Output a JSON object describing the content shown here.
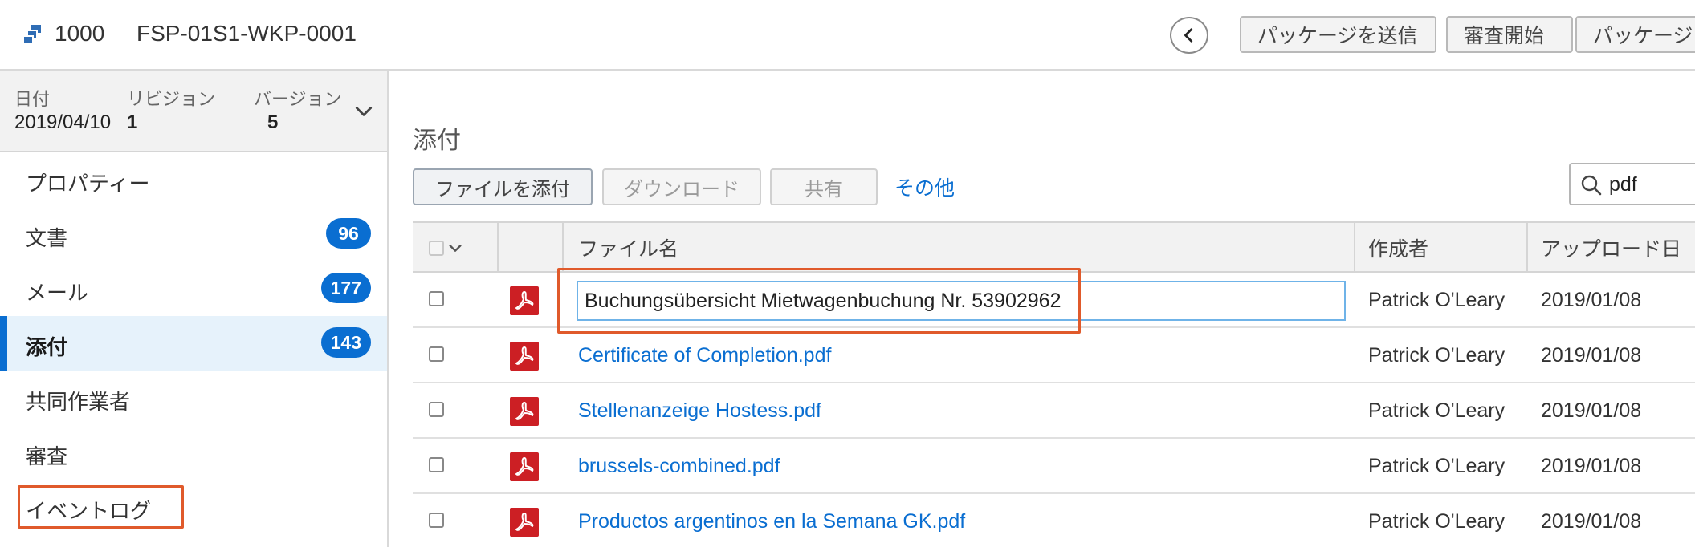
{
  "header": {
    "workpackage_number": "1000",
    "workpackage_name": "FSP-01S1-WKP-0001",
    "buttons": {
      "send_package": "パッケージを送信",
      "start_review": "審査開始",
      "package_more": "パッケージ"
    },
    "icons": {
      "workpackage": "stacked-squares-icon",
      "collapse": "chevron-left-icon"
    }
  },
  "revision": {
    "date_label": "日付",
    "date_value": "2019/04/10",
    "revision_label": "リビジョン",
    "revision_value": "1",
    "version_label": "バージョン",
    "version_value": "5"
  },
  "nav": {
    "items": [
      {
        "label": "プロパティー",
        "badge": null,
        "active": false
      },
      {
        "label": "文書",
        "badge": "96",
        "active": false
      },
      {
        "label": "メール",
        "badge": "177",
        "active": false
      },
      {
        "label": "添付",
        "badge": "143",
        "active": true
      },
      {
        "label": "共同作業者",
        "badge": null,
        "active": false
      },
      {
        "label": "審査",
        "badge": null,
        "active": false
      },
      {
        "label": "イベントログ",
        "badge": null,
        "active": false
      }
    ]
  },
  "attachments": {
    "title": "添付",
    "toolbar": {
      "attach_file": "ファイルを添付",
      "download": "ダウンロード",
      "share": "共有",
      "more": "その他"
    },
    "search": {
      "value": "pdf"
    },
    "columns": {
      "file_name": "ファイル名",
      "author": "作成者",
      "uploaded": "アップロード日"
    },
    "rows": [
      {
        "file_name": "Buchungsübersicht Mietwagenbuchung Nr. 53902962",
        "author": "Patrick O'Leary",
        "date": "2019/01/08",
        "editing": true
      },
      {
        "file_name": "Certificate of Completion.pdf",
        "author": "Patrick O'Leary",
        "date": "2019/01/08",
        "editing": false
      },
      {
        "file_name": "Stellenanzeige Hostess.pdf",
        "author": "Patrick O'Leary",
        "date": "2019/01/08",
        "editing": false
      },
      {
        "file_name": "brussels-combined.pdf",
        "author": "Patrick O'Leary",
        "date": "2019/01/08",
        "editing": false
      },
      {
        "file_name": "Productos argentinos en la Semana GK.pdf",
        "author": "Patrick O'Leary",
        "date": "2019/01/08",
        "editing": false
      }
    ]
  },
  "colors": {
    "accent": "#0a6ed1",
    "highlight": "#e05a2b",
    "pdf": "#cc1f24"
  }
}
